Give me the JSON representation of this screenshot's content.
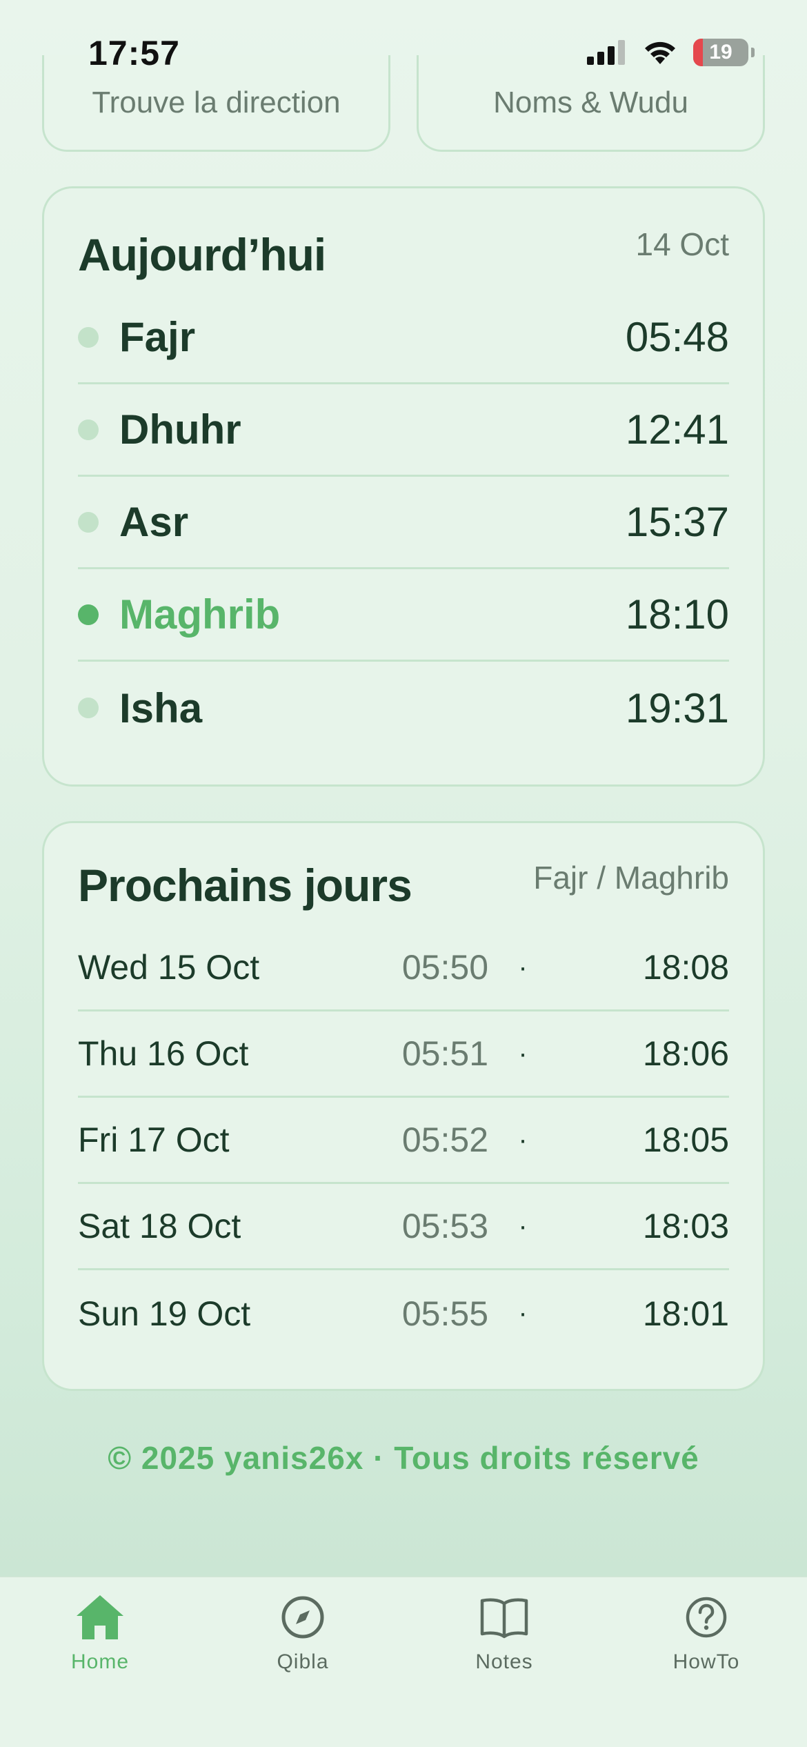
{
  "status_bar": {
    "time": "17:57",
    "battery": "19"
  },
  "quick_cards": [
    {
      "label": "Trouve la direction"
    },
    {
      "label": "Noms & Wudu"
    }
  ],
  "today": {
    "title": "Aujourd’hui",
    "date": "14 Oct",
    "prayers": [
      {
        "name": "Fajr",
        "time": "05:48",
        "active": false
      },
      {
        "name": "Dhuhr",
        "time": "12:41",
        "active": false
      },
      {
        "name": "Asr",
        "time": "15:37",
        "active": false
      },
      {
        "name": "Maghrib",
        "time": "18:10",
        "active": true
      },
      {
        "name": "Isha",
        "time": "19:31",
        "active": false
      }
    ]
  },
  "next_days": {
    "title": "Prochains jours",
    "meta": "Fajr / Maghrib",
    "separator": "·",
    "days": [
      {
        "label": "Wed 15 Oct",
        "fajr": "05:50",
        "maghrib": "18:08"
      },
      {
        "label": "Thu 16 Oct",
        "fajr": "05:51",
        "maghrib": "18:06"
      },
      {
        "label": "Fri 17 Oct",
        "fajr": "05:52",
        "maghrib": "18:05"
      },
      {
        "label": "Sat 18 Oct",
        "fajr": "05:53",
        "maghrib": "18:03"
      },
      {
        "label": "Sun 19 Oct",
        "fajr": "05:55",
        "maghrib": "18:01"
      }
    ]
  },
  "footer": {
    "copyright": "© 2025 yanis26x · Tous droits réservé"
  },
  "tab_bar": {
    "tabs": [
      {
        "label": "Home",
        "icon": "home-icon",
        "active": true
      },
      {
        "label": "Qibla",
        "icon": "compass-icon",
        "active": false
      },
      {
        "label": "Notes",
        "icon": "book-icon",
        "active": false
      },
      {
        "label": "HowTo",
        "icon": "help-circle-icon",
        "active": false
      }
    ]
  },
  "colors": {
    "accent": "#58b56a",
    "text": "#1c3b2a",
    "muted": "#6a7c70",
    "card_bg": "#e7f4ea",
    "border": "#c6e4cd"
  }
}
